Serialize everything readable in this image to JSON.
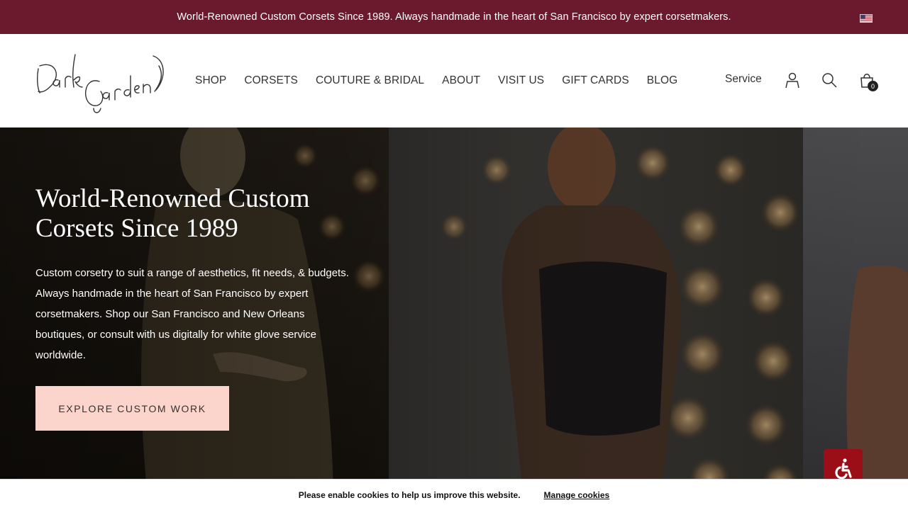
{
  "announcement": {
    "text": "World-Renowned Custom Corsets Since 1989. Always handmade in the heart of San Francisco by expert corsetmakers.",
    "flag_icon": "us-flag-icon"
  },
  "header": {
    "logo_alt": "Dark Garden",
    "nav": [
      "SHOP",
      "CORSETS",
      "COUTURE & BRIDAL",
      "ABOUT",
      "VISIT US",
      "GIFT CARDS",
      "BLOG"
    ],
    "service_label": "Service",
    "icons": [
      "account-icon",
      "search-icon",
      "cart-icon"
    ],
    "cart_count": "0"
  },
  "hero": {
    "title": "World-Renowned Custom Corsets Since 1989",
    "text": "Custom corsetry to suit a range of aesthetics, fit needs, & budgets. Always handmade in the heart of San Francisco by expert corsetmakers. Shop our San Francisco and New Orleans boutiques, or consult with us digitally for white glove service worldwide.",
    "button_label": "EXPLORE CUSTOM WORK"
  },
  "cookie": {
    "message": "Please enable cookies to help us improve this website.",
    "manage_label": "Manage cookies"
  },
  "colors": {
    "announcement_bg": "#6b1a2e",
    "button_bg": "#fbd5cb",
    "accessibility_bg": "#9b0d17"
  }
}
